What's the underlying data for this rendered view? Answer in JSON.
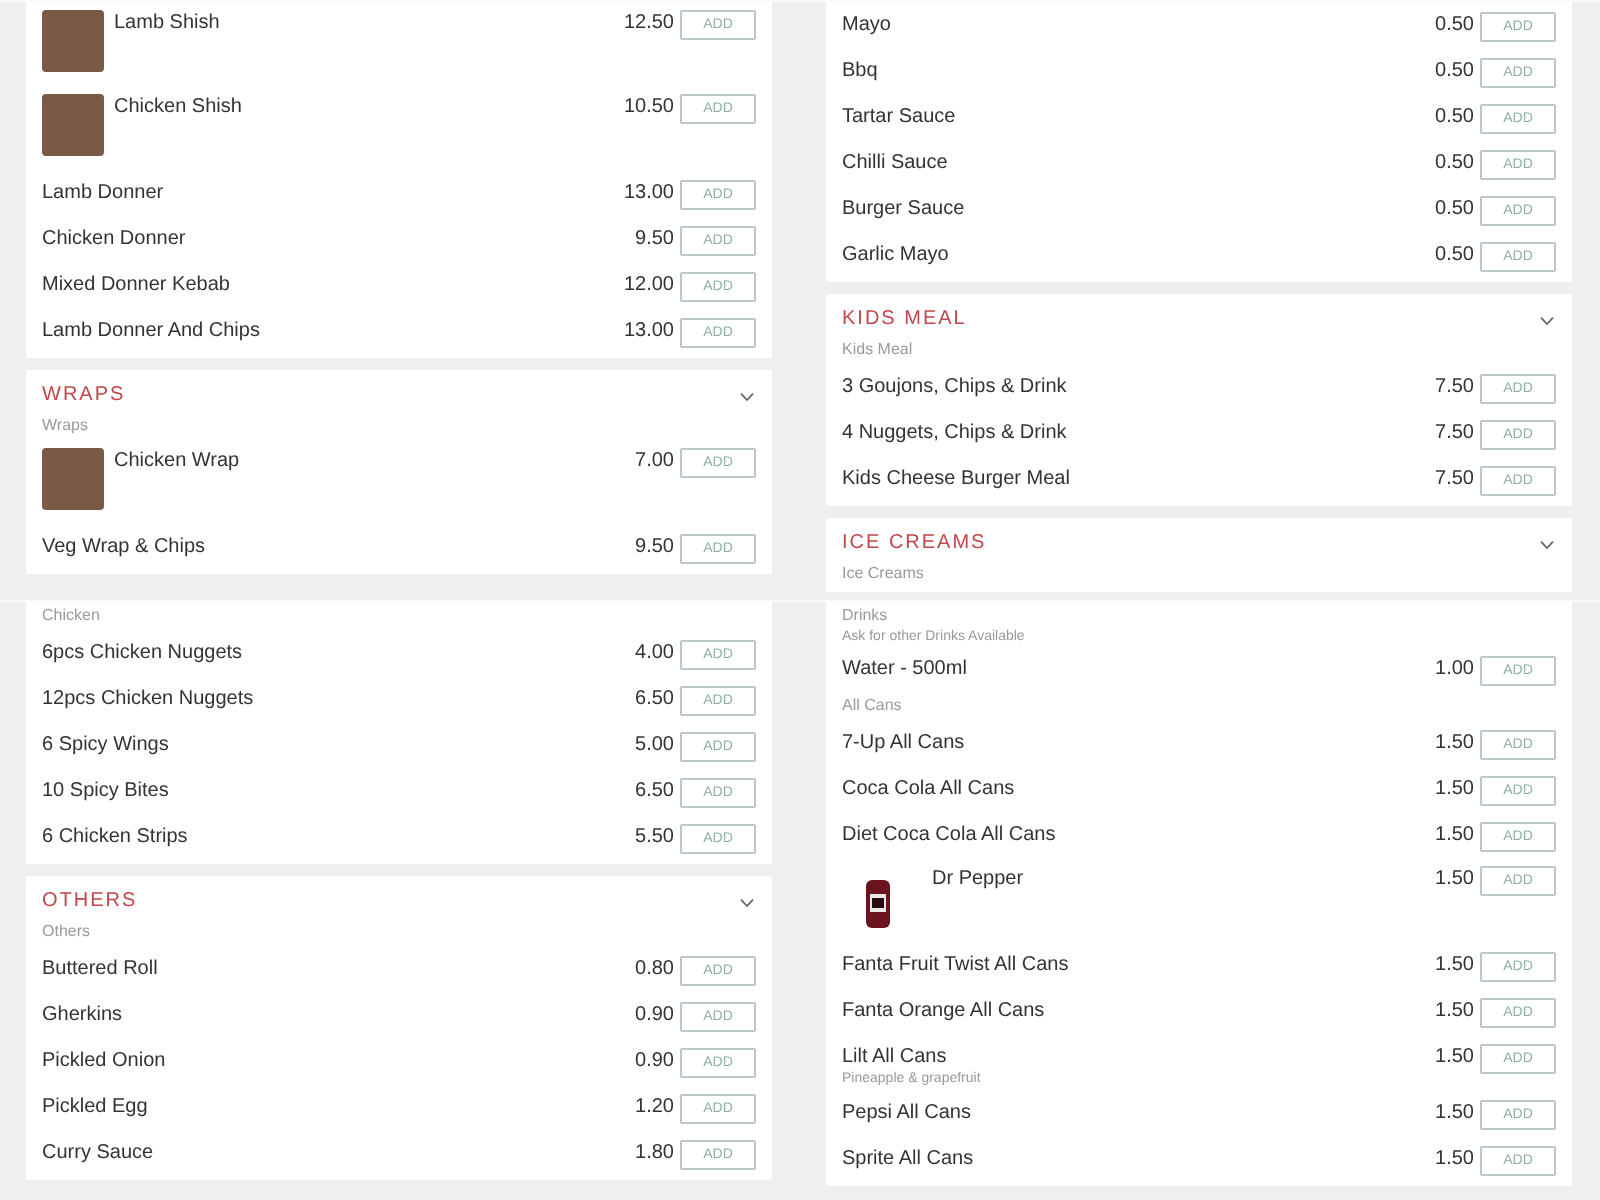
{
  "panes": [
    {
      "cards": [
        {
          "entries": [
            {
              "kind": "photo_item",
              "name": "Lamb Shish",
              "price": "12.50",
              "button": "ADD"
            },
            {
              "kind": "photo_item",
              "name": "Chicken Shish",
              "price": "10.50",
              "button": "ADD"
            },
            {
              "kind": "item",
              "name": "Lamb Donner",
              "price": "13.00",
              "button": "ADD"
            },
            {
              "kind": "item",
              "name": "Chicken Donner",
              "price": "9.50",
              "button": "ADD"
            },
            {
              "kind": "item",
              "name": "Mixed Donner Kebab",
              "price": "12.00",
              "button": "ADD"
            },
            {
              "kind": "item",
              "name": "Lamb Donner And Chips",
              "price": "13.00",
              "button": "ADD"
            }
          ]
        },
        {
          "title": "WRAPS",
          "entries": [
            {
              "kind": "subheading",
              "text": "Wraps"
            },
            {
              "kind": "photo_item",
              "name": "Chicken Wrap",
              "price": "7.00",
              "button": "ADD"
            },
            {
              "kind": "item",
              "name": "Veg Wrap & Chips",
              "price": "9.50",
              "button": "ADD"
            }
          ]
        }
      ]
    },
    {
      "cards": [
        {
          "entries": [
            {
              "kind": "item",
              "name": "Mayo",
              "price": "0.50",
              "button": "ADD"
            },
            {
              "kind": "item",
              "name": "Bbq",
              "price": "0.50",
              "button": "ADD"
            },
            {
              "kind": "item",
              "name": "Tartar Sauce",
              "price": "0.50",
              "button": "ADD"
            },
            {
              "kind": "item",
              "name": "Chilli Sauce",
              "price": "0.50",
              "button": "ADD"
            },
            {
              "kind": "item",
              "name": "Burger Sauce",
              "price": "0.50",
              "button": "ADD"
            },
            {
              "kind": "item",
              "name": "Garlic Mayo",
              "price": "0.50",
              "button": "ADD"
            }
          ]
        },
        {
          "title": "KIDS MEAL",
          "entries": [
            {
              "kind": "subheading",
              "text": "Kids Meal"
            },
            {
              "kind": "item",
              "name": "3 Goujons, Chips & Drink",
              "price": "7.50",
              "button": "ADD"
            },
            {
              "kind": "item",
              "name": "4 Nuggets, Chips & Drink",
              "price": "7.50",
              "button": "ADD"
            },
            {
              "kind": "item",
              "name": "Kids Cheese Burger Meal",
              "price": "7.50",
              "button": "ADD"
            }
          ]
        },
        {
          "title": "ICE CREAMS",
          "entries": [
            {
              "kind": "subheading",
              "text": "Ice Creams"
            }
          ]
        }
      ]
    },
    {
      "cards": [
        {
          "entries": [
            {
              "kind": "subheading",
              "text": "Chicken"
            },
            {
              "kind": "item",
              "name": "6pcs Chicken Nuggets",
              "price": "4.00",
              "button": "ADD"
            },
            {
              "kind": "item",
              "name": "12pcs Chicken Nuggets",
              "price": "6.50",
              "button": "ADD"
            },
            {
              "kind": "item",
              "name": "6 Spicy Wings",
              "price": "5.00",
              "button": "ADD"
            },
            {
              "kind": "item",
              "name": "10 Spicy Bites",
              "price": "6.50",
              "button": "ADD"
            },
            {
              "kind": "item",
              "name": "6 Chicken Strips",
              "price": "5.50",
              "button": "ADD"
            }
          ]
        },
        {
          "title": "OTHERS",
          "entries": [
            {
              "kind": "subheading",
              "text": "Others"
            },
            {
              "kind": "item",
              "name": "Buttered Roll",
              "price": "0.80",
              "button": "ADD"
            },
            {
              "kind": "item",
              "name": "Gherkins",
              "price": "0.90",
              "button": "ADD"
            },
            {
              "kind": "item",
              "name": "Pickled Onion",
              "price": "0.90",
              "button": "ADD"
            },
            {
              "kind": "item",
              "name": "Pickled Egg",
              "price": "1.20",
              "button": "ADD"
            },
            {
              "kind": "item",
              "name": "Curry Sauce",
              "price": "1.80",
              "button": "ADD"
            }
          ]
        }
      ]
    },
    {
      "cards": [
        {
          "entries": [
            {
              "kind": "subheading",
              "text": "Drinks"
            },
            {
              "kind": "note",
              "text": "Ask for other Drinks Available"
            },
            {
              "kind": "item",
              "name": "Water - 500ml",
              "price": "1.00",
              "button": "ADD"
            },
            {
              "kind": "subheading",
              "text": "All Cans"
            },
            {
              "kind": "item",
              "name": "7-Up All Cans",
              "price": "1.50",
              "button": "ADD"
            },
            {
              "kind": "item",
              "name": "Coca Cola All Cans",
              "price": "1.50",
              "button": "ADD"
            },
            {
              "kind": "item",
              "name": "Diet Coca Cola All Cans",
              "price": "1.50",
              "button": "ADD"
            },
            {
              "kind": "can_item",
              "name": "Dr Pepper",
              "price": "1.50",
              "button": "ADD"
            },
            {
              "kind": "item",
              "name": "Fanta Fruit Twist All Cans",
              "price": "1.50",
              "button": "ADD"
            },
            {
              "kind": "item",
              "name": "Fanta Orange All Cans",
              "price": "1.50",
              "button": "ADD"
            },
            {
              "kind": "item",
              "name": "Lilt All Cans",
              "description": "Pineapple & grapefruit",
              "price": "1.50",
              "button": "ADD"
            },
            {
              "kind": "item",
              "name": "Pepsi All Cans",
              "price": "1.50",
              "button": "ADD"
            },
            {
              "kind": "item",
              "name": "Sprite All Cans",
              "price": "1.50",
              "button": "ADD"
            }
          ]
        }
      ]
    }
  ]
}
